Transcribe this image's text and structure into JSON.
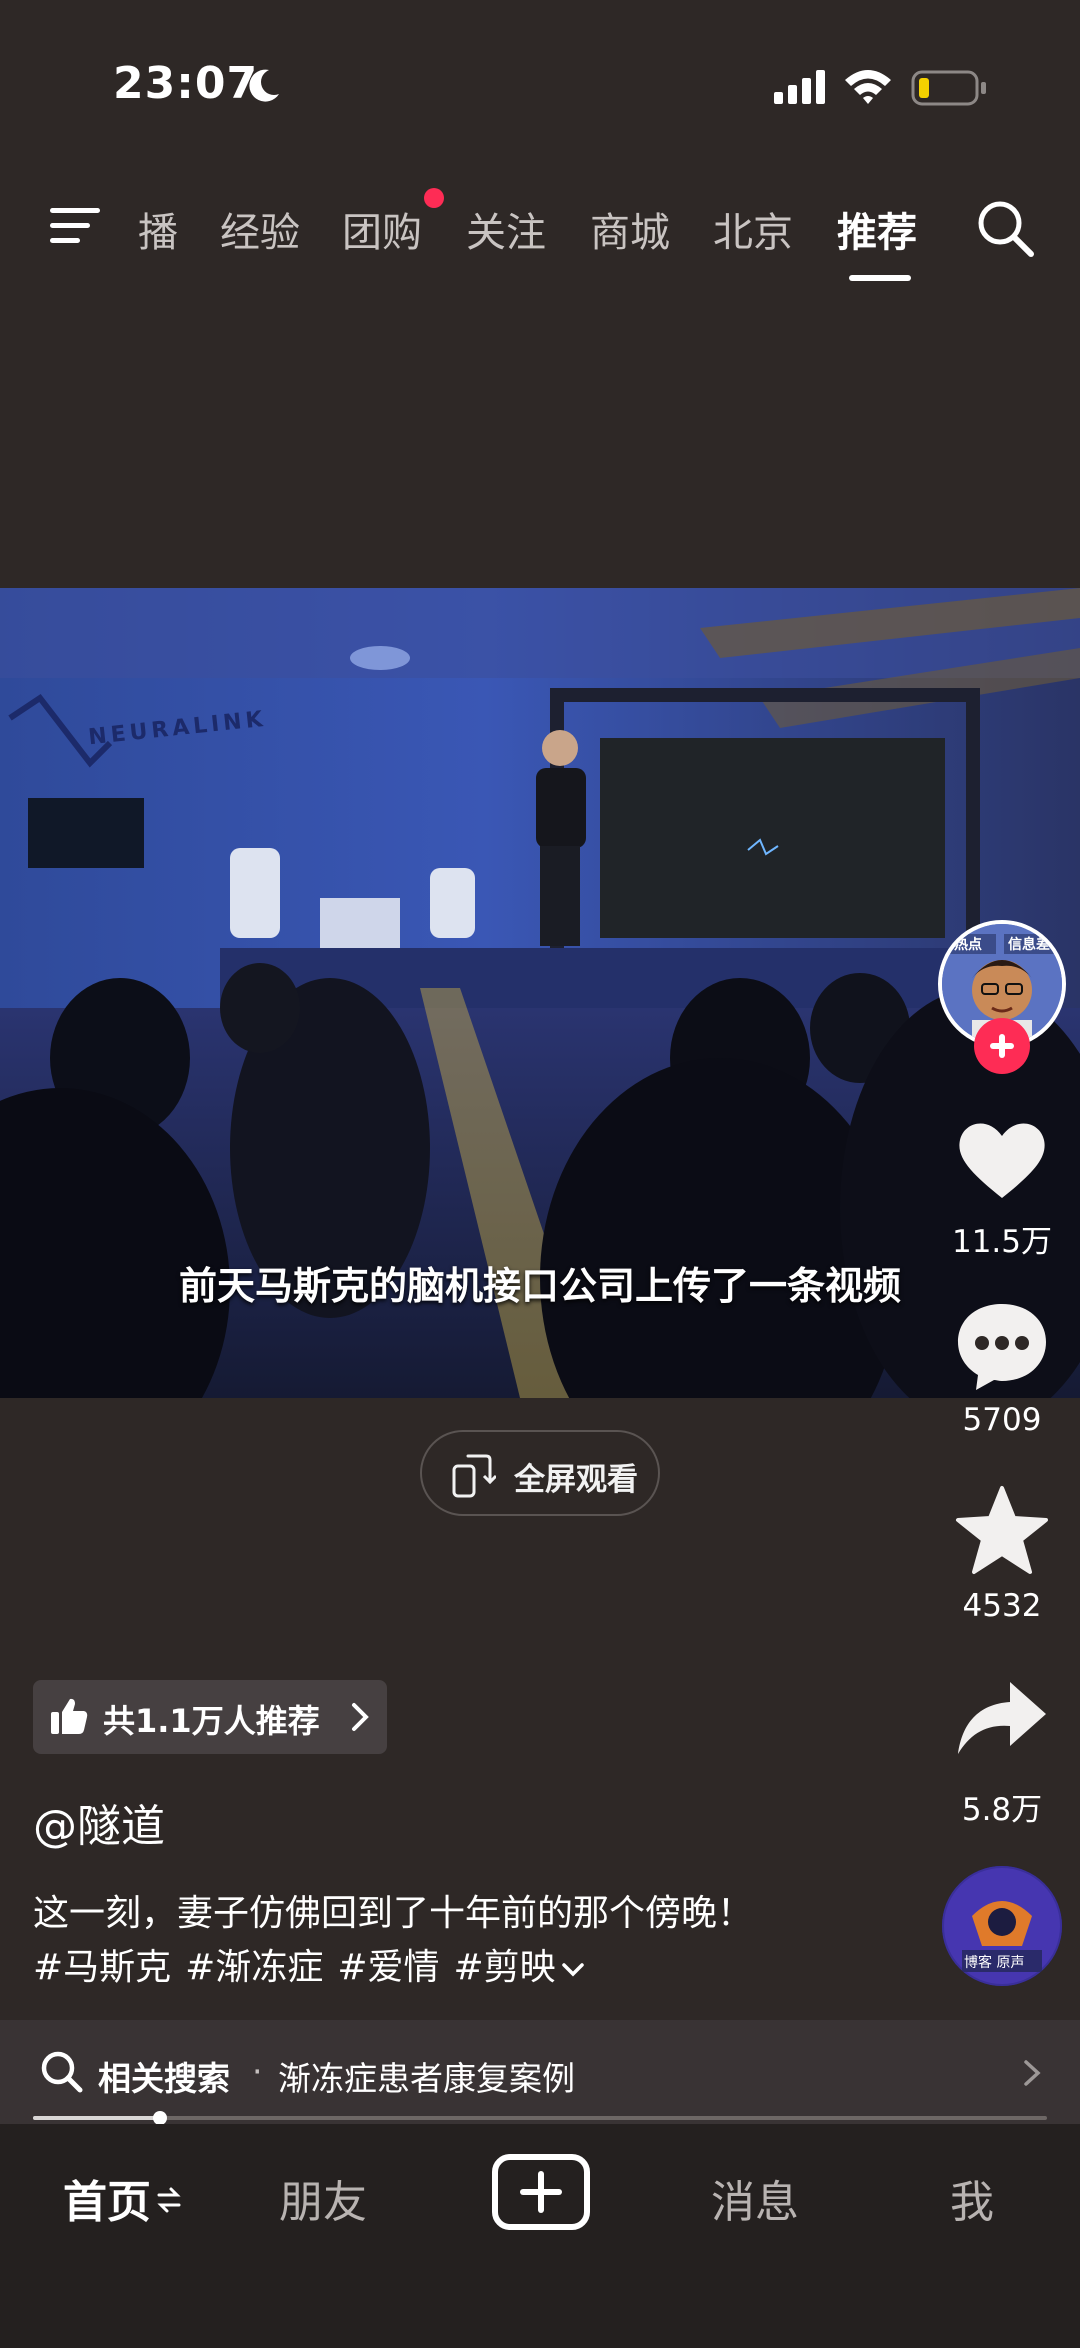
{
  "status_bar": {
    "time": "23:07"
  },
  "top_nav": {
    "tabs": [
      "播",
      "经验",
      "团购",
      "关注",
      "商城",
      "北京",
      "推荐"
    ],
    "active_tab": "推荐"
  },
  "video": {
    "subtitle": "前天马斯克的脑机接口公司上传了一条视频",
    "sign_text": "NEURALINK",
    "progress": 0.125
  },
  "fullscreen_button": {
    "label": "全屏观看"
  },
  "actions": {
    "like_count": "11.5万",
    "comment_count": "5709",
    "favorite_count": "4532",
    "share_count": "5.8万"
  },
  "creator": {
    "avatar_tag_left": "热点",
    "avatar_tag_right": "信息差",
    "disc_label": "博客 原声"
  },
  "caption": {
    "recommend": "共1.1万人推荐",
    "author": "@隧道",
    "text": "这一刻，妻子仿佛回到了十年前的那个傍晚！",
    "hashtags": [
      "#马斯克",
      "#渐冻症",
      "#爱情",
      "#剪映"
    ]
  },
  "related_search": {
    "prefix": "相关搜索",
    "separator": "·",
    "query": "渐冻症患者康复案例"
  },
  "bottom_tabs": {
    "home": "首页",
    "friends": "朋友",
    "messages": "消息",
    "me": "我"
  },
  "colors": {
    "background": "#2e2826",
    "accent_red": "#fe2c55",
    "battery_low": "#f5d100"
  }
}
